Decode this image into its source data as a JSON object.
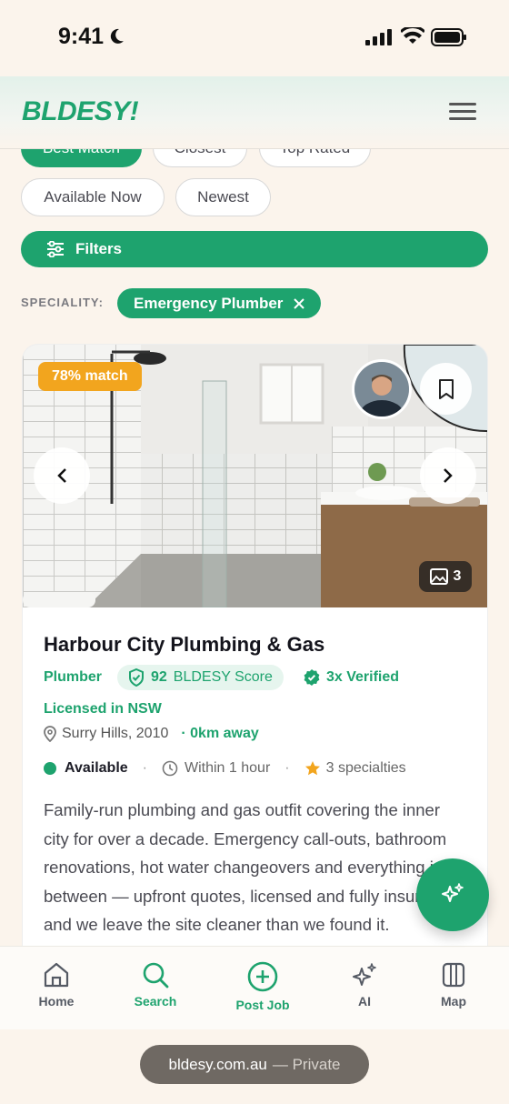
{
  "status_bar": {
    "time": "9:41"
  },
  "header": {
    "logo": "BLDESY!"
  },
  "sort_chips": [
    {
      "label": "Best Match",
      "active": true
    },
    {
      "label": "Closest"
    },
    {
      "label": "Top Rated"
    },
    {
      "label": "Available Now"
    },
    {
      "label": "Newest"
    }
  ],
  "filters": {
    "label": "Filters"
  },
  "speciality": {
    "label": "SPECIALITY:",
    "chip": "Emergency Plumber"
  },
  "listing": {
    "match": "78% match",
    "photo_count": "3",
    "name": "Harbour City Plumbing & Gas",
    "trade": "Plumber",
    "score_value": "92",
    "score_label": "BLDESY Score",
    "verified": "3x Verified",
    "licensed": "Licensed in NSW",
    "location": "Surry Hills, 2010",
    "distance": "· 0km away",
    "availability": "Available",
    "response": "Within 1 hour",
    "specialties": "3 specialties",
    "description": "Family-run plumbing and gas outfit covering the inner city for over a decade. Emergency call-outs, bathroom renovations, hot water changeovers and everything in between — upfront quotes, licensed and fully insured, and we leave the site cleaner than we found it."
  },
  "bottom_nav": [
    {
      "label": "Home",
      "icon": "home-icon"
    },
    {
      "label": "Search",
      "icon": "search-icon",
      "active": true
    },
    {
      "label": "Post Job",
      "icon": "plus-circle-icon"
    },
    {
      "label": "AI",
      "icon": "sparkle-icon"
    },
    {
      "label": "Map",
      "icon": "map-icon"
    }
  ],
  "browser": {
    "domain": "bldesy.com.au",
    "mode": "— Private"
  },
  "colors": {
    "brand": "#1ea36e",
    "match": "#f2a51e",
    "background": "#fbf4ec"
  }
}
